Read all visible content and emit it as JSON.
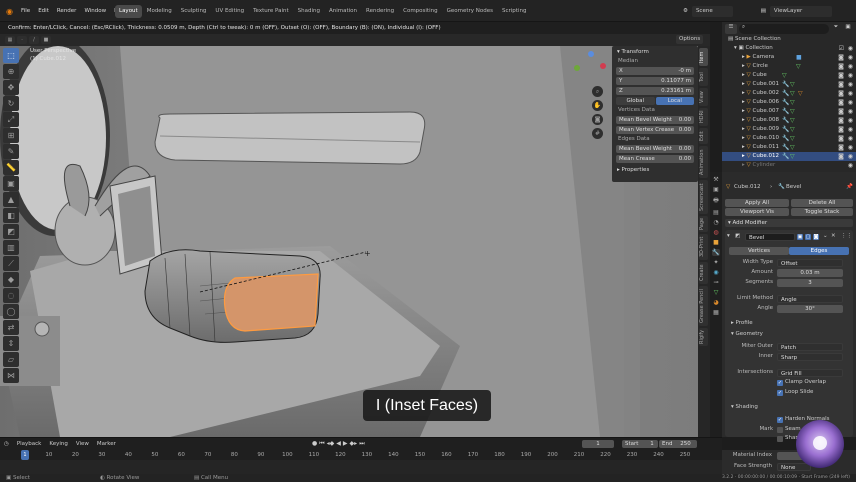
{
  "menu": {
    "items": [
      "File",
      "Edit",
      "Render",
      "Window",
      "Help"
    ]
  },
  "workspaces": [
    "Layout",
    "Modeling",
    "Sculpting",
    "UV Editing",
    "Texture Paint",
    "Shading",
    "Animation",
    "Rendering",
    "Compositing",
    "Geometry Nodes",
    "Scripting"
  ],
  "scene": {
    "label": "Scene",
    "view_layer": "ViewLayer"
  },
  "header_status": "Confirm: Enter/LClick, Cancel: (Esc/RClick), Thickness: 0.0509 m, Depth (Ctrl to tweak): 0 m (OFF), Outset (O): (OFF), Boundary (B): (ON), Individual (I): (OFF)",
  "viewport": {
    "perspective": "User Perspective",
    "object": "(1) Cube.012",
    "options": "Options"
  },
  "npanel": {
    "transform": "Transform",
    "median": "Median",
    "x_label": "X",
    "x_val": "-0 m",
    "y_label": "Y",
    "y_val": "0.11077 m",
    "z_label": "Z",
    "z_val": "0.23161 m",
    "global": "Global",
    "local": "Local",
    "vertices_data": "Vertices Data",
    "mean_bevel_weight": "Mean Bevel Weight",
    "mbw_val": "0.00",
    "mean_vertex_crease": "Mean Vertex Crease",
    "mvc_val": "0.00",
    "edges_data": "Edges Data",
    "e_mbw": "Mean Bevel Weight",
    "e_mbw_val": "0.00",
    "mean_crease": "Mean Crease",
    "mc_val": "0.00",
    "properties": "Properties"
  },
  "side_tabs": [
    "Item",
    "Tool",
    "View",
    "HDRI",
    "Edit",
    "Animation",
    "Screencast",
    "Page",
    "3D-Print",
    "Create",
    "Grease Pencil",
    "Rigify"
  ],
  "outliner": {
    "scene_collection": "Scene Collection",
    "rows": [
      {
        "name": "Collection"
      },
      {
        "name": "Camera"
      },
      {
        "name": "Circle"
      },
      {
        "name": "Cube"
      },
      {
        "name": "Cube.001"
      },
      {
        "name": "Cube.002"
      },
      {
        "name": "Cube.006"
      },
      {
        "name": "Cube.007"
      },
      {
        "name": "Cube.008"
      },
      {
        "name": "Cube.009"
      },
      {
        "name": "Cube.010"
      },
      {
        "name": "Cube.011"
      },
      {
        "name": "Cube.012"
      },
      {
        "name": "Cylinder"
      }
    ]
  },
  "properties": {
    "object": "Cube.012",
    "modifier_stack": "Bevel",
    "apply_all": "Apply All",
    "delete_all": "Delete All",
    "viewport_vis": "Viewport Vis",
    "toggle_stack": "Toggle Stack",
    "add_modifier": "Add Modifier",
    "modifier_name": "Bevel",
    "vertices": "Vertices",
    "edges": "Edges",
    "width_type_label": "Width Type",
    "width_type": "Offset",
    "amount_label": "Amount",
    "amount": "0.03 m",
    "segments_label": "Segments",
    "segments": "3",
    "limit_method_label": "Limit Method",
    "limit_method": "Angle",
    "angle_label": "Angle",
    "angle": "30°",
    "profile": "Profile",
    "geometry": "Geometry",
    "miter_outer_label": "Miter Outer",
    "miter_outer": "Patch",
    "inner_label": "Inner",
    "inner": "Sharp",
    "intersections_label": "Intersections",
    "intersections": "Grid Fill",
    "clamp_overlap": "Clamp Overlap",
    "loop_slide": "Loop Slide",
    "shading": "Shading",
    "harden_normals": "Harden Normals",
    "mark_label": "Mark",
    "seam": "Seam",
    "sharp": "Sharp",
    "material_index_label": "Material Index",
    "face_strength_label": "Face Strength",
    "face_strength": "None"
  },
  "timeline": {
    "playback": "Playback",
    "keying": "Keying",
    "view": "View",
    "marker": "Marker",
    "current_frame": "1",
    "start_label": "Start",
    "start": "1",
    "end_label": "End",
    "end": "250",
    "ticks": [
      "1",
      "10",
      "20",
      "30",
      "40",
      "50",
      "60",
      "70",
      "80",
      "90",
      "100",
      "110",
      "120",
      "130",
      "140",
      "150",
      "160",
      "170",
      "180",
      "190",
      "200",
      "210",
      "220",
      "230",
      "240",
      "250"
    ]
  },
  "status": {
    "select": "Select",
    "rotate_view": "Rotate View",
    "call_menu": "Call Menu",
    "version": "3.2.2 · 00:00:00:00 / 00:00:10:09 · Start Frame (249 left)"
  },
  "caption": "I (Inset Faces)",
  "colors": {
    "accent": "#4772b3",
    "selected_row": "#334d80",
    "inset_face": "#d4956a",
    "viewport_bg": "#5b5b5b"
  }
}
